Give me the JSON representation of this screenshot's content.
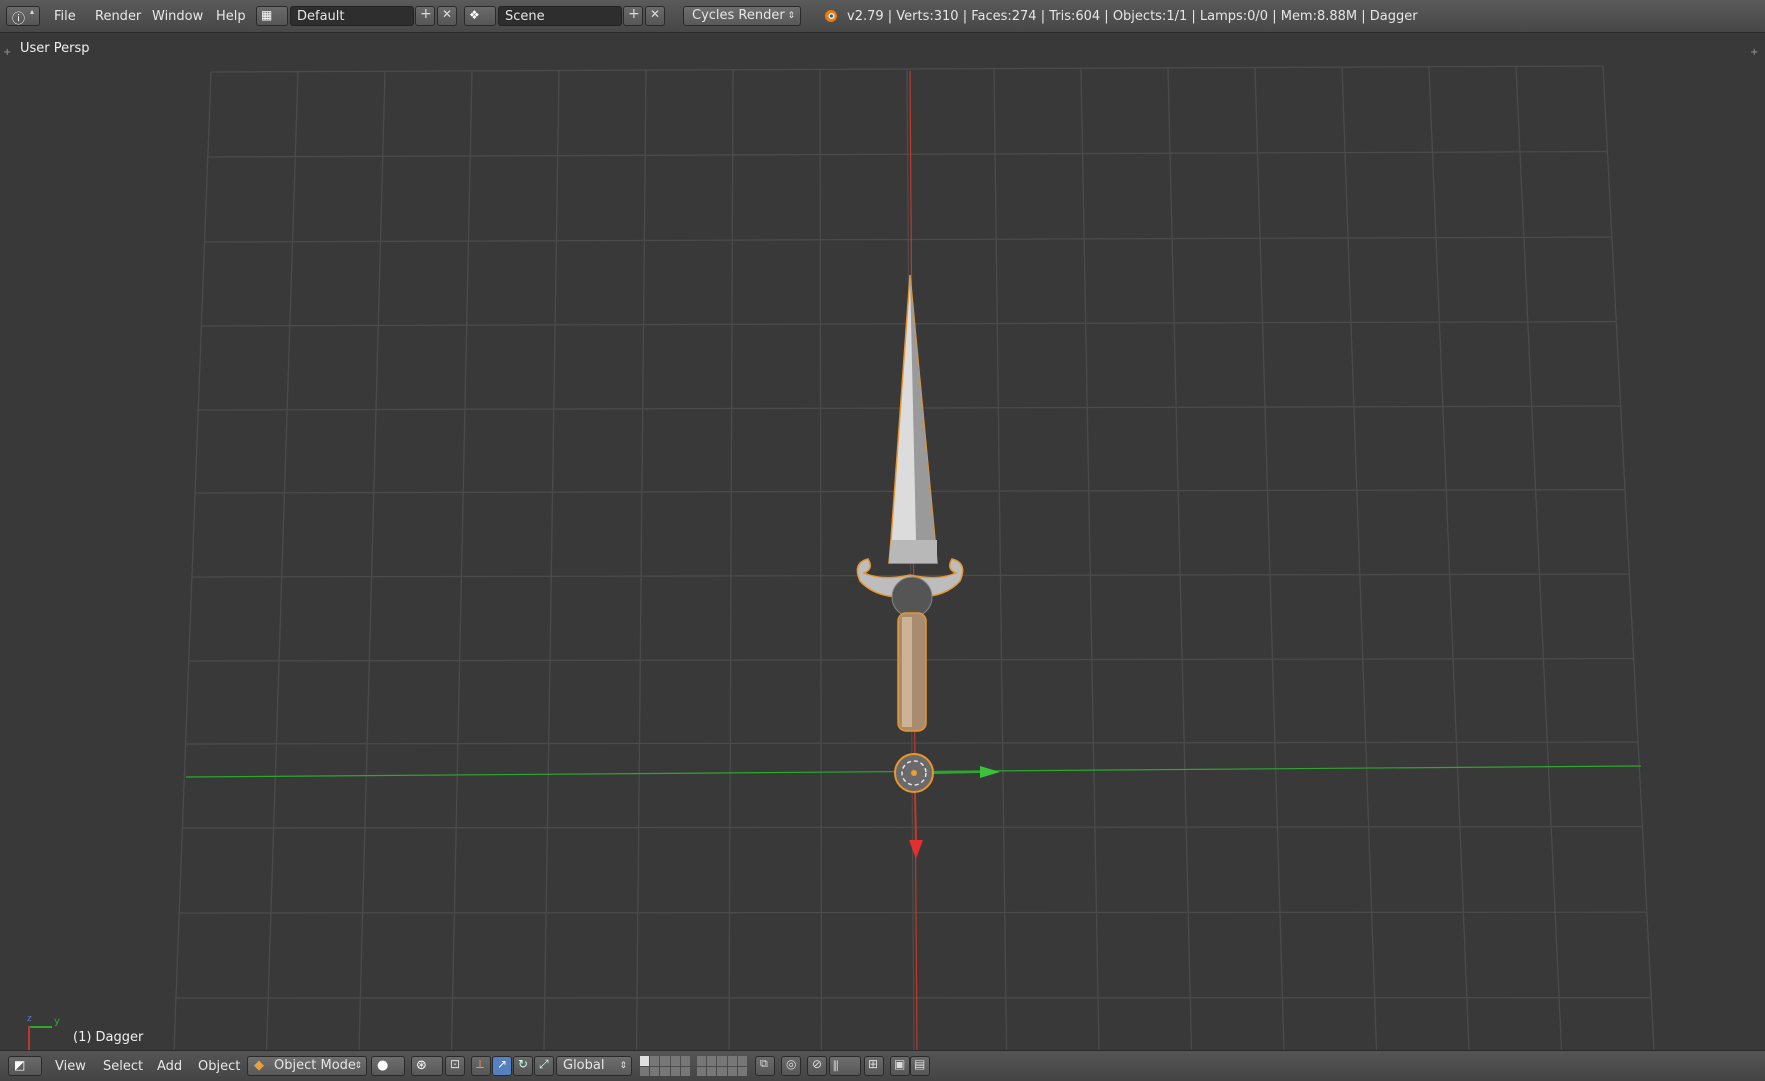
{
  "topbar": {
    "menus": [
      "File",
      "Render",
      "Window",
      "Help"
    ],
    "screen_layout": "Default",
    "scene": "Scene",
    "render_engine": "Cycles Render",
    "stats": "v2.79 | Verts:310 | Faces:274 | Tris:604 | Objects:1/1 | Lamps:0/0 | Mem:8.88M | Dagger"
  },
  "viewport": {
    "view_label": "User Persp",
    "object_label": "(1) Dagger",
    "axis_x": "x",
    "axis_y": "y",
    "axis_z": "z"
  },
  "bottombar": {
    "menus": [
      "View",
      "Select",
      "Add",
      "Object"
    ],
    "mode": "Object Mode",
    "transform_orientation": "Global"
  },
  "colors": {
    "viewport_bg": "#393939",
    "grid": "#4b4b4b",
    "x_axis": "#c0392b",
    "y_axis": "#2ca82c",
    "selection_outline": "#e8962d"
  },
  "icons": [
    "info-icon",
    "layout-icon",
    "add-icon",
    "close-icon",
    "scene-icon",
    "blender-logo-icon",
    "3d-view-icon",
    "object-mode-icon",
    "viewport-shading-icon",
    "pivot-icon",
    "manipulator-icon",
    "layers-icon",
    "proportional-edit-icon",
    "snap-icon",
    "render-preview-icon"
  ]
}
